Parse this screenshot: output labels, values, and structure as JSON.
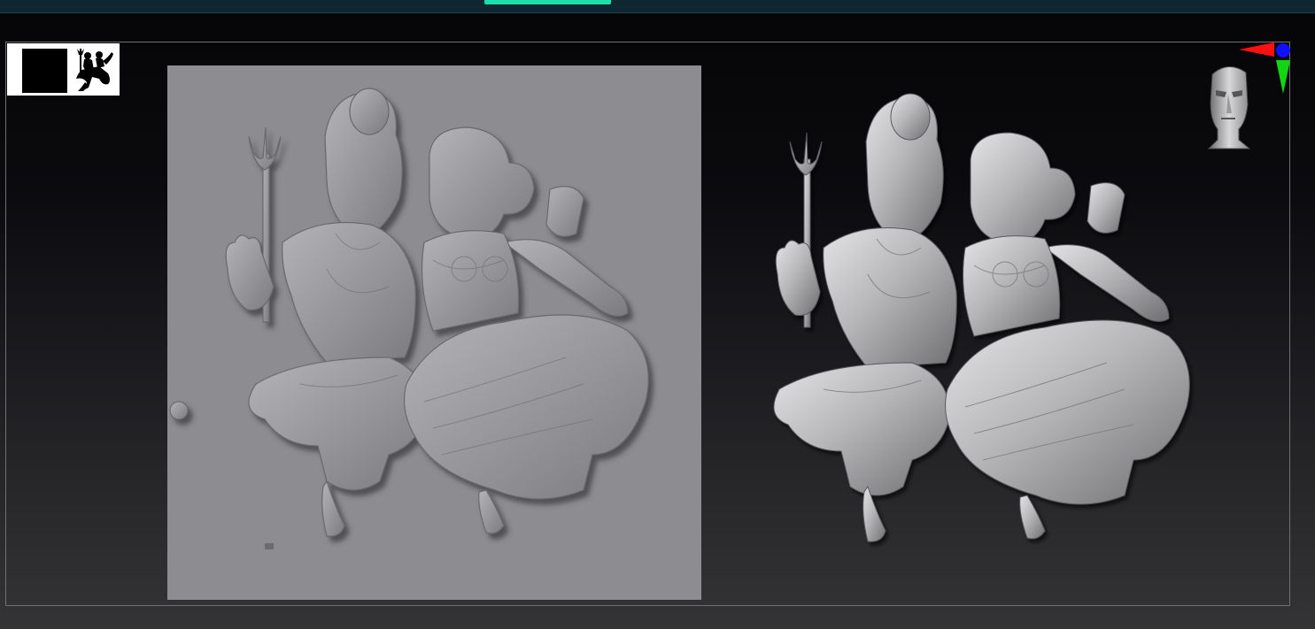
{
  "app": {
    "top_bar": {
      "progress_fraction": 0.096,
      "accent_color": "#1de0a8",
      "bar_color": "#0e2730"
    }
  },
  "viewport": {
    "background_gradient": [
      "#050507",
      "#343436"
    ],
    "border_color": "#707070"
  },
  "thumbnail": {
    "icon": "shiva-parvati-silhouette-icon"
  },
  "depth_map": {
    "background_color": "#8d8c90",
    "subject": "shiva-parvati-relief"
  },
  "render": {
    "subject": "shiva-parvati-relief",
    "material_color": "#b8b8ba"
  },
  "navigation": {
    "head_icon": "nav-head-icon",
    "axis_colors": {
      "x": "#ff1010",
      "y": "#12d612",
      "z": "#1010ff"
    }
  }
}
